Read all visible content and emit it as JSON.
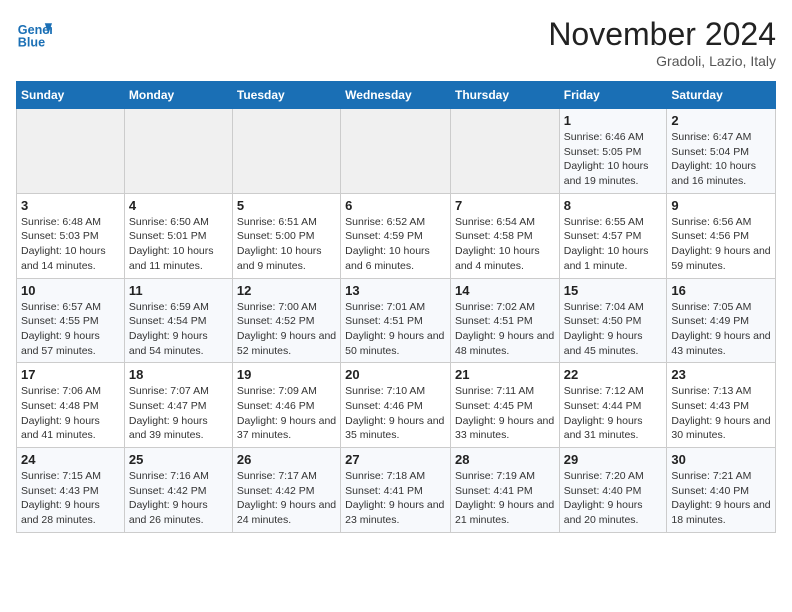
{
  "header": {
    "logo_line1": "General",
    "logo_line2": "Blue",
    "month_title": "November 2024",
    "location": "Gradoli, Lazio, Italy"
  },
  "weekdays": [
    "Sunday",
    "Monday",
    "Tuesday",
    "Wednesday",
    "Thursday",
    "Friday",
    "Saturday"
  ],
  "weeks": [
    [
      {
        "day": "",
        "info": ""
      },
      {
        "day": "",
        "info": ""
      },
      {
        "day": "",
        "info": ""
      },
      {
        "day": "",
        "info": ""
      },
      {
        "day": "",
        "info": ""
      },
      {
        "day": "1",
        "info": "Sunrise: 6:46 AM\nSunset: 5:05 PM\nDaylight: 10 hours and 19 minutes."
      },
      {
        "day": "2",
        "info": "Sunrise: 6:47 AM\nSunset: 5:04 PM\nDaylight: 10 hours and 16 minutes."
      }
    ],
    [
      {
        "day": "3",
        "info": "Sunrise: 6:48 AM\nSunset: 5:03 PM\nDaylight: 10 hours and 14 minutes."
      },
      {
        "day": "4",
        "info": "Sunrise: 6:50 AM\nSunset: 5:01 PM\nDaylight: 10 hours and 11 minutes."
      },
      {
        "day": "5",
        "info": "Sunrise: 6:51 AM\nSunset: 5:00 PM\nDaylight: 10 hours and 9 minutes."
      },
      {
        "day": "6",
        "info": "Sunrise: 6:52 AM\nSunset: 4:59 PM\nDaylight: 10 hours and 6 minutes."
      },
      {
        "day": "7",
        "info": "Sunrise: 6:54 AM\nSunset: 4:58 PM\nDaylight: 10 hours and 4 minutes."
      },
      {
        "day": "8",
        "info": "Sunrise: 6:55 AM\nSunset: 4:57 PM\nDaylight: 10 hours and 1 minute."
      },
      {
        "day": "9",
        "info": "Sunrise: 6:56 AM\nSunset: 4:56 PM\nDaylight: 9 hours and 59 minutes."
      }
    ],
    [
      {
        "day": "10",
        "info": "Sunrise: 6:57 AM\nSunset: 4:55 PM\nDaylight: 9 hours and 57 minutes."
      },
      {
        "day": "11",
        "info": "Sunrise: 6:59 AM\nSunset: 4:54 PM\nDaylight: 9 hours and 54 minutes."
      },
      {
        "day": "12",
        "info": "Sunrise: 7:00 AM\nSunset: 4:52 PM\nDaylight: 9 hours and 52 minutes."
      },
      {
        "day": "13",
        "info": "Sunrise: 7:01 AM\nSunset: 4:51 PM\nDaylight: 9 hours and 50 minutes."
      },
      {
        "day": "14",
        "info": "Sunrise: 7:02 AM\nSunset: 4:51 PM\nDaylight: 9 hours and 48 minutes."
      },
      {
        "day": "15",
        "info": "Sunrise: 7:04 AM\nSunset: 4:50 PM\nDaylight: 9 hours and 45 minutes."
      },
      {
        "day": "16",
        "info": "Sunrise: 7:05 AM\nSunset: 4:49 PM\nDaylight: 9 hours and 43 minutes."
      }
    ],
    [
      {
        "day": "17",
        "info": "Sunrise: 7:06 AM\nSunset: 4:48 PM\nDaylight: 9 hours and 41 minutes."
      },
      {
        "day": "18",
        "info": "Sunrise: 7:07 AM\nSunset: 4:47 PM\nDaylight: 9 hours and 39 minutes."
      },
      {
        "day": "19",
        "info": "Sunrise: 7:09 AM\nSunset: 4:46 PM\nDaylight: 9 hours and 37 minutes."
      },
      {
        "day": "20",
        "info": "Sunrise: 7:10 AM\nSunset: 4:46 PM\nDaylight: 9 hours and 35 minutes."
      },
      {
        "day": "21",
        "info": "Sunrise: 7:11 AM\nSunset: 4:45 PM\nDaylight: 9 hours and 33 minutes."
      },
      {
        "day": "22",
        "info": "Sunrise: 7:12 AM\nSunset: 4:44 PM\nDaylight: 9 hours and 31 minutes."
      },
      {
        "day": "23",
        "info": "Sunrise: 7:13 AM\nSunset: 4:43 PM\nDaylight: 9 hours and 30 minutes."
      }
    ],
    [
      {
        "day": "24",
        "info": "Sunrise: 7:15 AM\nSunset: 4:43 PM\nDaylight: 9 hours and 28 minutes."
      },
      {
        "day": "25",
        "info": "Sunrise: 7:16 AM\nSunset: 4:42 PM\nDaylight: 9 hours and 26 minutes."
      },
      {
        "day": "26",
        "info": "Sunrise: 7:17 AM\nSunset: 4:42 PM\nDaylight: 9 hours and 24 minutes."
      },
      {
        "day": "27",
        "info": "Sunrise: 7:18 AM\nSunset: 4:41 PM\nDaylight: 9 hours and 23 minutes."
      },
      {
        "day": "28",
        "info": "Sunrise: 7:19 AM\nSunset: 4:41 PM\nDaylight: 9 hours and 21 minutes."
      },
      {
        "day": "29",
        "info": "Sunrise: 7:20 AM\nSunset: 4:40 PM\nDaylight: 9 hours and 20 minutes."
      },
      {
        "day": "30",
        "info": "Sunrise: 7:21 AM\nSunset: 4:40 PM\nDaylight: 9 hours and 18 minutes."
      }
    ]
  ]
}
